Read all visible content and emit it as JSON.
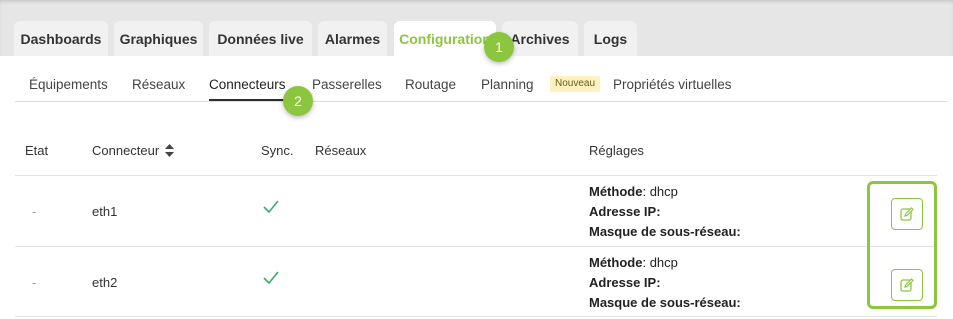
{
  "tabs": [
    {
      "label": "Dashboards"
    },
    {
      "label": "Graphiques"
    },
    {
      "label": "Données live"
    },
    {
      "label": "Alarmes"
    },
    {
      "label": "Configuration"
    },
    {
      "label": "Archives"
    },
    {
      "label": "Logs"
    }
  ],
  "active_tab": "Configuration",
  "subnav": [
    {
      "label": "Équipements"
    },
    {
      "label": "Réseaux"
    },
    {
      "label": "Connecteurs"
    },
    {
      "label": "Passerelles"
    },
    {
      "label": "Routage"
    },
    {
      "label": "Planning"
    },
    {
      "label": "Propriétés virtuelles"
    }
  ],
  "active_subnav": "Connecteurs",
  "planning_badge": "Nouveau",
  "steps": [
    "1",
    "2"
  ],
  "table": {
    "headers": {
      "etat": "Etat",
      "connecteur": "Connecteur",
      "sync": "Sync.",
      "reseaux": "Réseaux",
      "reglages": "Réglages"
    },
    "rows": [
      {
        "etat": "-",
        "connecteur": "eth1",
        "sync": "check-icon",
        "methode_label": "Méthode",
        "methode_value": "dhcp",
        "ip_label": "Adresse IP",
        "mask_label": "Masque de sous-réseau"
      },
      {
        "etat": "-",
        "connecteur": "eth2",
        "sync": "check-icon",
        "methode_label": "Méthode",
        "methode_value": "dhcp",
        "ip_label": "Adresse IP",
        "mask_label": "Masque de sous-réseau"
      }
    ]
  },
  "colors": {
    "accent": "#8cc63f",
    "badge_bg": "#fdf1bf"
  },
  "icons": {
    "sort": "sort-icon",
    "sync_ok": "check-icon",
    "edit": "edit-icon"
  }
}
